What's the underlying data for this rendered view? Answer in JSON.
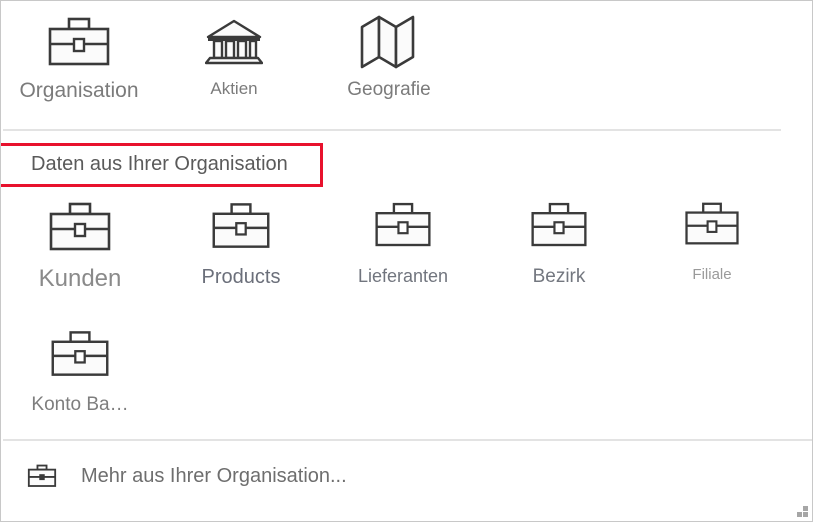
{
  "panel": {
    "background": "#ffffff",
    "border_color": "#c8c8c8"
  },
  "categories": [
    {
      "label": "Organisation",
      "icon": "briefcase-icon"
    },
    {
      "label": "Aktien",
      "icon": "bank-icon"
    },
    {
      "label": "Geografie",
      "icon": "map-icon"
    }
  ],
  "section": {
    "heading": "Daten aus Ihrer Organisation",
    "annotation_color": "#e8112d"
  },
  "entities": [
    {
      "label": "Kunden",
      "icon": "briefcase-icon"
    },
    {
      "label": "Products",
      "icon": "briefcase-icon"
    },
    {
      "label": "Lieferanten",
      "icon": "briefcase-icon"
    },
    {
      "label": "Bezirk",
      "icon": "briefcase-icon"
    },
    {
      "label": "Filiale",
      "icon": "briefcase-icon"
    },
    {
      "label": "Konto Ba…",
      "icon": "briefcase-icon"
    }
  ],
  "footer": {
    "label": "Mehr aus Ihrer Organisation...",
    "icon": "briefcase-icon"
  },
  "resize_grip": {
    "name": "resize-grip",
    "color": "#a6a6a6"
  },
  "colors": {
    "icon_stroke": "#3a3a3a",
    "label_gray": "#7b7b7b",
    "divider": "#e3e3e3",
    "annotation_red": "#e8112d"
  }
}
